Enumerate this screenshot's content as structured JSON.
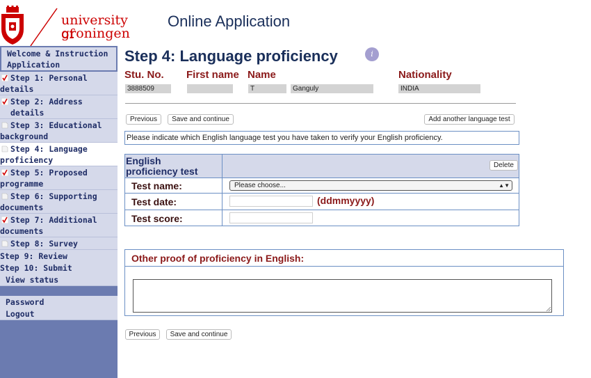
{
  "brand": {
    "logo_line1": "university of",
    "logo_line2": "groningen",
    "brand_red": "#cc0000",
    "app_title": "Online Application"
  },
  "sidebar": {
    "items": [
      {
        "line1": "Welcome & Instruction",
        "line2": "Application",
        "icon": "none"
      },
      {
        "line1": "Step 1: Personal",
        "line2": "details",
        "icon": "check-icon"
      },
      {
        "line1": "Step 2: Address details",
        "line2": "",
        "icon": "check-icon"
      },
      {
        "line1": "Step 3: Educational",
        "line2": "background",
        "icon": "blank-icon"
      },
      {
        "line1": "Step 4: Language",
        "line2": "proficiency",
        "icon": "blank-icon"
      },
      {
        "line1": "Step 5: Proposed",
        "line2": "programme",
        "icon": "check-icon"
      },
      {
        "line1": "Step 6: Supporting",
        "line2": "documents",
        "icon": "blank-icon"
      },
      {
        "line1": "Step 7: Additional",
        "line2": "documents",
        "icon": "check-icon"
      },
      {
        "line1": "Step 8: Survey",
        "line2": "",
        "icon": "blank-icon"
      },
      {
        "line1": "Step 9: Review",
        "line2": "",
        "icon": "none"
      },
      {
        "line1": "Step 10: Submit",
        "line2": "",
        "icon": "none"
      },
      {
        "line1": "View status",
        "line2": "",
        "icon": "none"
      }
    ],
    "account": [
      {
        "label": "Password"
      },
      {
        "label": "Logout"
      }
    ],
    "active_index": 4
  },
  "main": {
    "title": "Step 4: Language proficiency",
    "info_icon": "i",
    "headers": {
      "stu_no": "Stu. No.",
      "first_name": "First name",
      "name": "Name",
      "nationality": "Nationality"
    },
    "values": {
      "stu_no": "3888509",
      "first_name": "",
      "initial": "T",
      "surname": "Ganguly",
      "nationality": "INDIA"
    },
    "buttons": {
      "previous": "Previous",
      "save_continue": "Save and continue",
      "add_test": "Add another language test",
      "delete": "Delete"
    },
    "instruction": "Please indicate which English language test you have taken to verify your English proficiency.",
    "test_section": {
      "title_line1": "English",
      "title_line2": "proficiency test",
      "test_name_label": "Test name:",
      "test_name_value": "Please choose...",
      "test_date_label": "Test date:",
      "test_date_format": "(ddmmyyyy)",
      "test_date_value": "",
      "test_score_label": "Test score:",
      "test_score_value": ""
    },
    "other_proof": {
      "title": "Other proof of proficiency in English:",
      "value": ""
    }
  }
}
